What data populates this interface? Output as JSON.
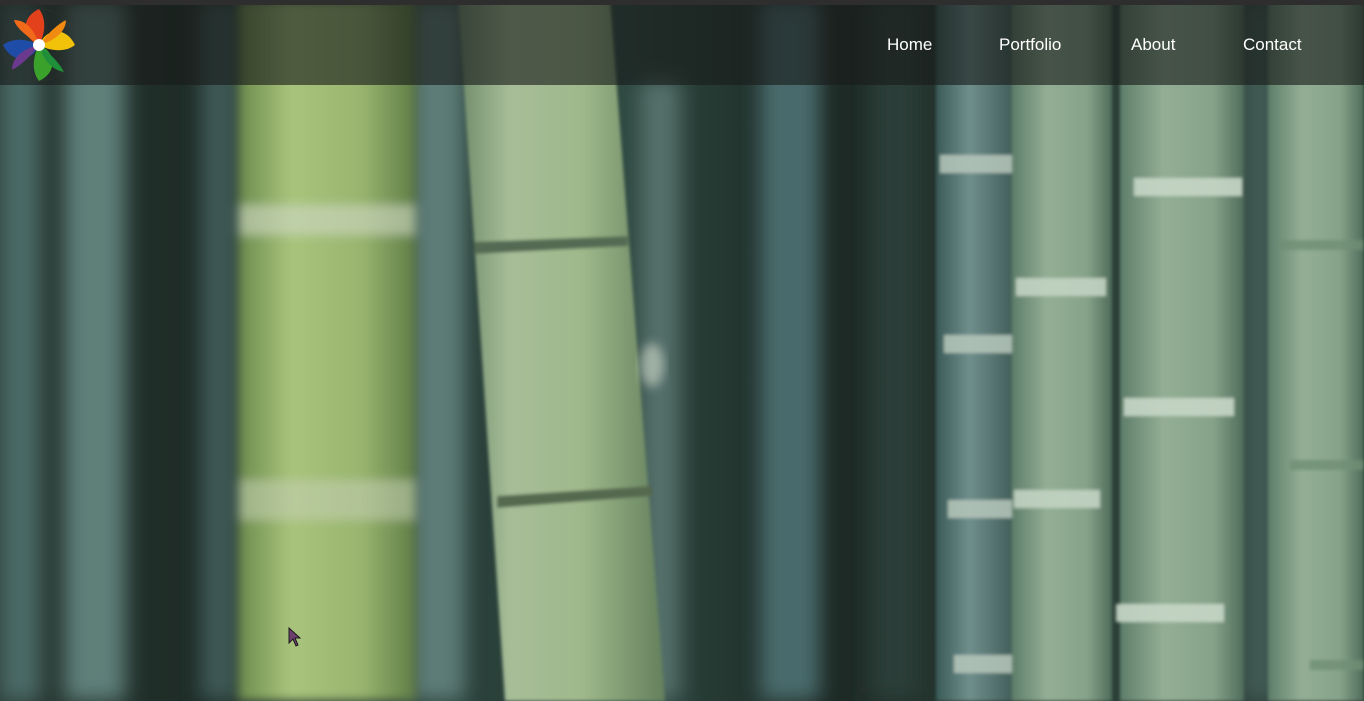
{
  "header": {
    "logo": {
      "icon": "color-wheel-logo-icon"
    },
    "nav": [
      {
        "label": "Home"
      },
      {
        "label": "Portfolio"
      },
      {
        "label": "About"
      },
      {
        "label": "Contact"
      }
    ]
  },
  "hero": {
    "background_icon": "bamboo-forest-background",
    "colors": {
      "bamboo_light": "#9fbf78",
      "bamboo_mid": "#6e8f7f",
      "bamboo_dark": "#1f2a27",
      "header_overlay": "#1a1d1b"
    }
  },
  "cursor": {
    "icon": "mouse-pointer-icon"
  }
}
